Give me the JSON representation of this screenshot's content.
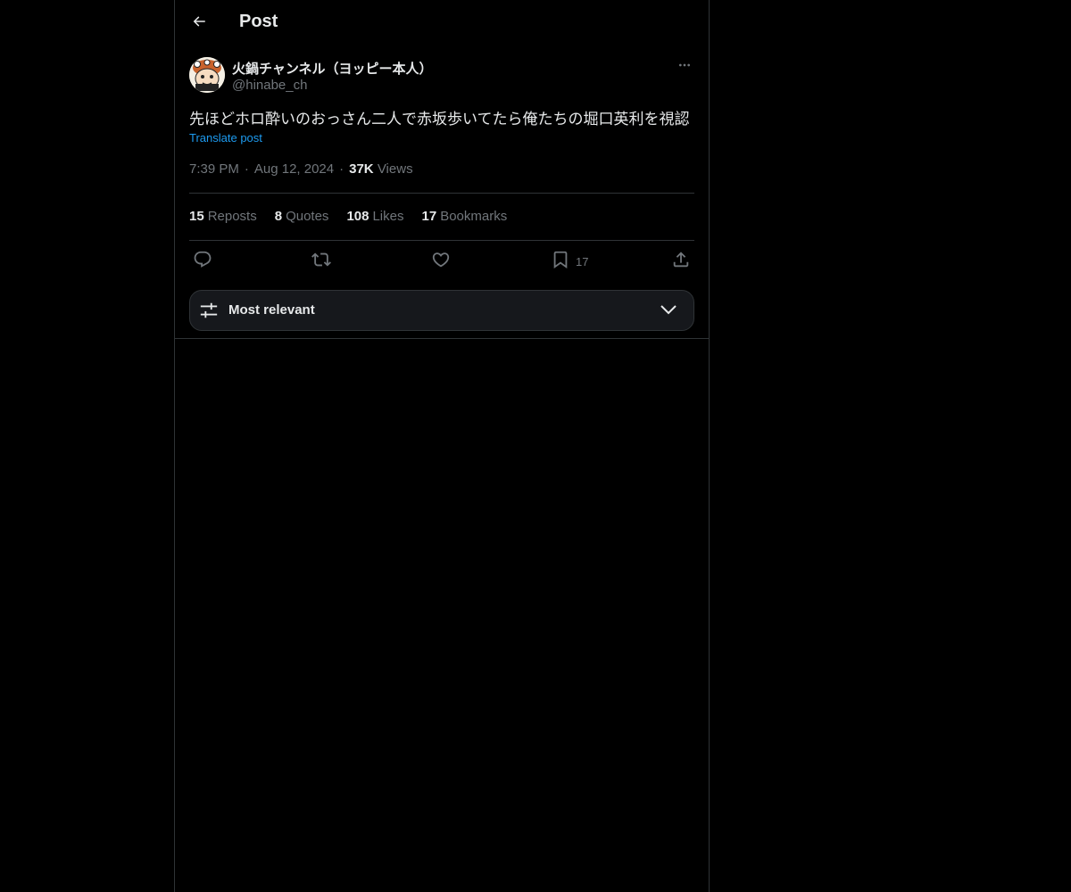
{
  "header": {
    "title": "Post"
  },
  "tweet": {
    "display_name": "火鍋チャンネル（ヨッピー本人）",
    "handle": "@hinabe_ch",
    "text": "先ほどホロ酔いのおっさん二人で赤坂歩いてたら俺たちの堀口英利を視認",
    "translate_label": "Translate post",
    "time": "7:39 PM",
    "date": "Aug 12, 2024",
    "views_count": "37K",
    "views_label": "Views"
  },
  "stats": {
    "reposts_count": "15",
    "reposts_label": "Reposts",
    "quotes_count": "8",
    "quotes_label": "Quotes",
    "likes_count": "108",
    "likes_label": "Likes",
    "bookmarks_count": "17",
    "bookmarks_label": "Bookmarks"
  },
  "actions": {
    "reply_icon": "reply-icon",
    "repost_icon": "repost-icon",
    "like_icon": "heart-icon",
    "bookmark_icon": "bookmark-icon",
    "bookmark_count": "17",
    "share_icon": "share-icon"
  },
  "sort": {
    "label": "Most relevant"
  },
  "colors": {
    "background": "#000000",
    "text_primary": "#e7e9ea",
    "text_secondary": "#71767b",
    "accent": "#1d9bf0",
    "border": "#2f3336"
  }
}
